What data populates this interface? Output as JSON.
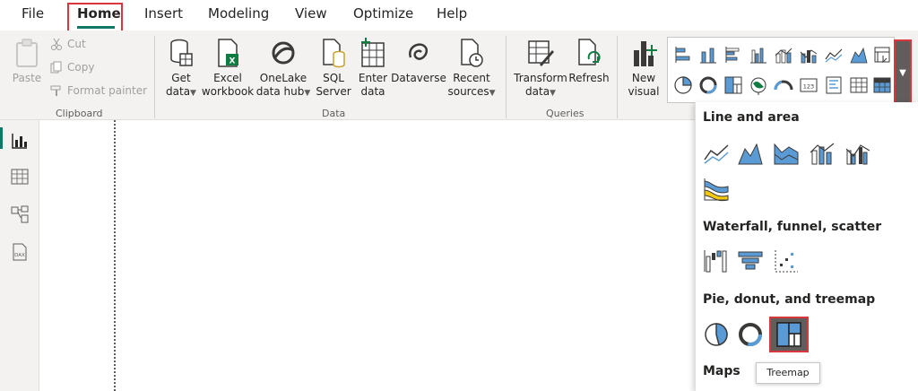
{
  "tabs": [
    {
      "label": "File"
    },
    {
      "label": "Home",
      "active": true
    },
    {
      "label": "Insert"
    },
    {
      "label": "Modeling"
    },
    {
      "label": "View"
    },
    {
      "label": "Optimize"
    },
    {
      "label": "Help"
    }
  ],
  "clipboard": {
    "paste": "Paste",
    "cut": "Cut",
    "copy": "Copy",
    "format_painter": "Format painter",
    "group": "Clipboard"
  },
  "data_group": {
    "get_data": [
      "Get",
      "data"
    ],
    "excel": [
      "Excel",
      "workbook"
    ],
    "onelake": [
      "OneLake",
      "data hub"
    ],
    "sql": [
      "SQL",
      "Server"
    ],
    "enter": [
      "Enter",
      "data"
    ],
    "dataverse": "Dataverse",
    "recent": [
      "Recent",
      "sources"
    ],
    "group": "Data"
  },
  "queries": {
    "transform": [
      "Transform",
      "data"
    ],
    "refresh": "Refresh",
    "group": "Queries"
  },
  "insert": {
    "new_visual": [
      "New",
      "visual"
    ]
  },
  "panel": {
    "line_area": "Line and area",
    "waterfall": "Waterfall, funnel, scatter",
    "pie": "Pie, donut, and treemap",
    "maps": "Maps"
  },
  "tooltip": "Treemap",
  "colors": {
    "accent": "#117865",
    "highlight": "#d9363e",
    "icon_blue": "#5b9bd5",
    "icon_dark": "#3b3a39"
  }
}
